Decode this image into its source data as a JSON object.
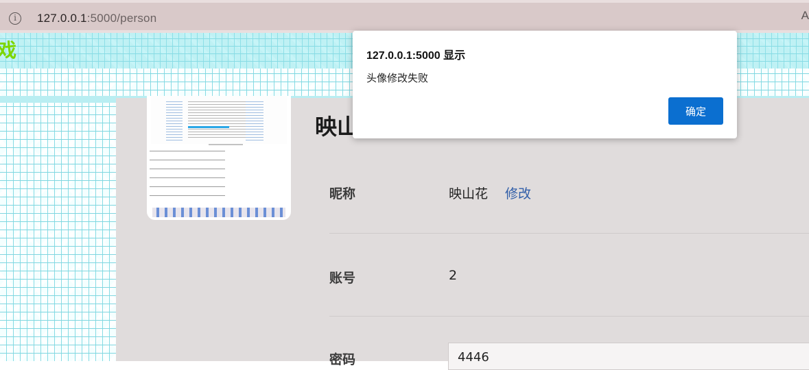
{
  "browser": {
    "url_host": "127.0.0.1",
    "url_rest": ":5000/person",
    "right_char": "A"
  },
  "header": {
    "logo_glyph": "戏"
  },
  "profile": {
    "title": "映山",
    "rows": [
      {
        "label": "昵称",
        "value": "映山花",
        "action": "修改"
      },
      {
        "label": "账号",
        "value": "2"
      },
      {
        "label": "密码",
        "value": "4446"
      }
    ]
  },
  "dialog": {
    "title": "127.0.0.1:5000 显示",
    "message": "头像修改失败",
    "ok_label": "确定"
  },
  "colors": {
    "accent": "#0b6fd0",
    "link": "#2f5da8",
    "maze": "#86dbe4"
  }
}
